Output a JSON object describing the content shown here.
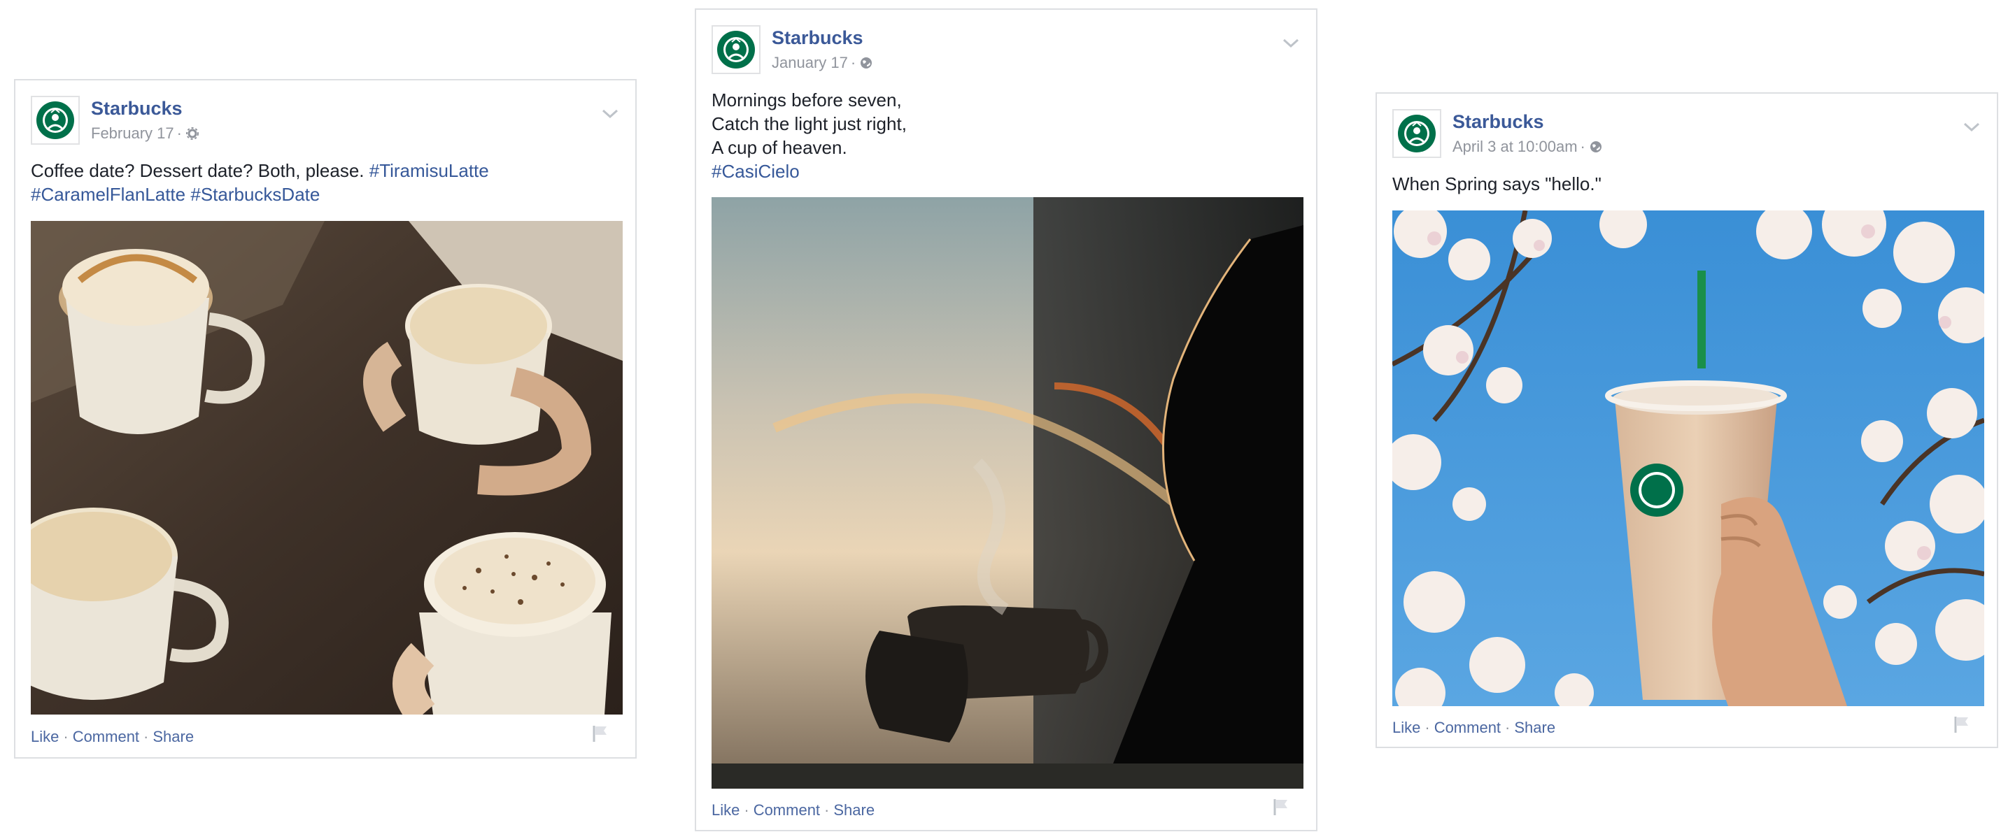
{
  "posts": [
    {
      "page_name": "Starbucks",
      "date": "February 17",
      "audience_icon": "gear-icon",
      "text_lines": [
        [
          {
            "t": "Coffee date? Dessert date? Both, please. ",
            "tag": false
          },
          {
            "t": "#TiramisuLatte",
            "tag": true
          }
        ],
        [
          {
            "t": "#CaramelFlanLatte",
            "tag": true
          },
          {
            "t": " ",
            "tag": false
          },
          {
            "t": "#StarbucksDate",
            "tag": true
          }
        ]
      ],
      "photo_subject": "coffee-mugs-on-table",
      "actions": {
        "like": "Like",
        "comment": "Comment",
        "share": "Share"
      }
    },
    {
      "page_name": "Starbucks",
      "date": "January 17",
      "audience_icon": "globe-icon",
      "text_lines": [
        [
          {
            "t": "Mornings before seven,",
            "tag": false
          }
        ],
        [
          {
            "t": "Catch the light just right,",
            "tag": false
          }
        ],
        [
          {
            "t": "A cup of heaven.",
            "tag": false
          }
        ],
        [
          {
            "t": "#CasiCielo",
            "tag": true
          }
        ]
      ],
      "photo_subject": "hands-holding-steaming-mug",
      "actions": {
        "like": "Like",
        "comment": "Comment",
        "share": "Share"
      }
    },
    {
      "page_name": "Starbucks",
      "date": "April 3 at 10:00am",
      "audience_icon": "globe-icon",
      "text_lines": [
        [
          {
            "t": "When Spring says \"hello.\"",
            "tag": false
          }
        ]
      ],
      "photo_subject": "iced-drink-cherry-blossoms",
      "actions": {
        "like": "Like",
        "comment": "Comment",
        "share": "Share"
      }
    }
  ],
  "colors": {
    "link": "#365899",
    "name": "#3b5998",
    "meta": "#90949c",
    "border": "#dddfe2",
    "brand_green": "#00704a"
  }
}
